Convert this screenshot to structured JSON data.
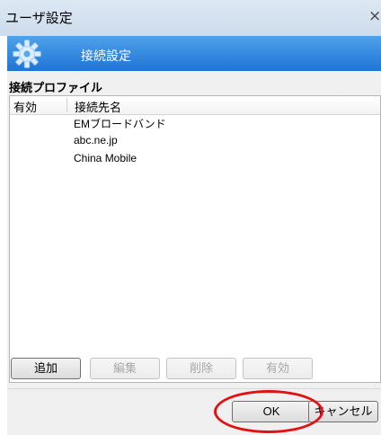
{
  "window": {
    "title": "ユーザ設定",
    "close_glyph": "×"
  },
  "banner": {
    "title": "接続設定",
    "icon": "gear-icon",
    "color": "#2b7fde"
  },
  "profiles": {
    "section_title": "接続プロファイル",
    "columns": [
      "有効",
      "接続先名"
    ],
    "rows": [
      {
        "enabled": "",
        "name": "EMブロードバンド"
      },
      {
        "enabled": "",
        "name": "abc.ne.jp"
      },
      {
        "enabled": "",
        "name": "China Mobile"
      }
    ]
  },
  "buttons": {
    "add": "追加",
    "edit": "編集",
    "delete": "削除",
    "enable": "有効",
    "ok": "OK",
    "cancel": "キャンセル"
  },
  "annotation": {
    "highlight_color": "#e01212"
  }
}
